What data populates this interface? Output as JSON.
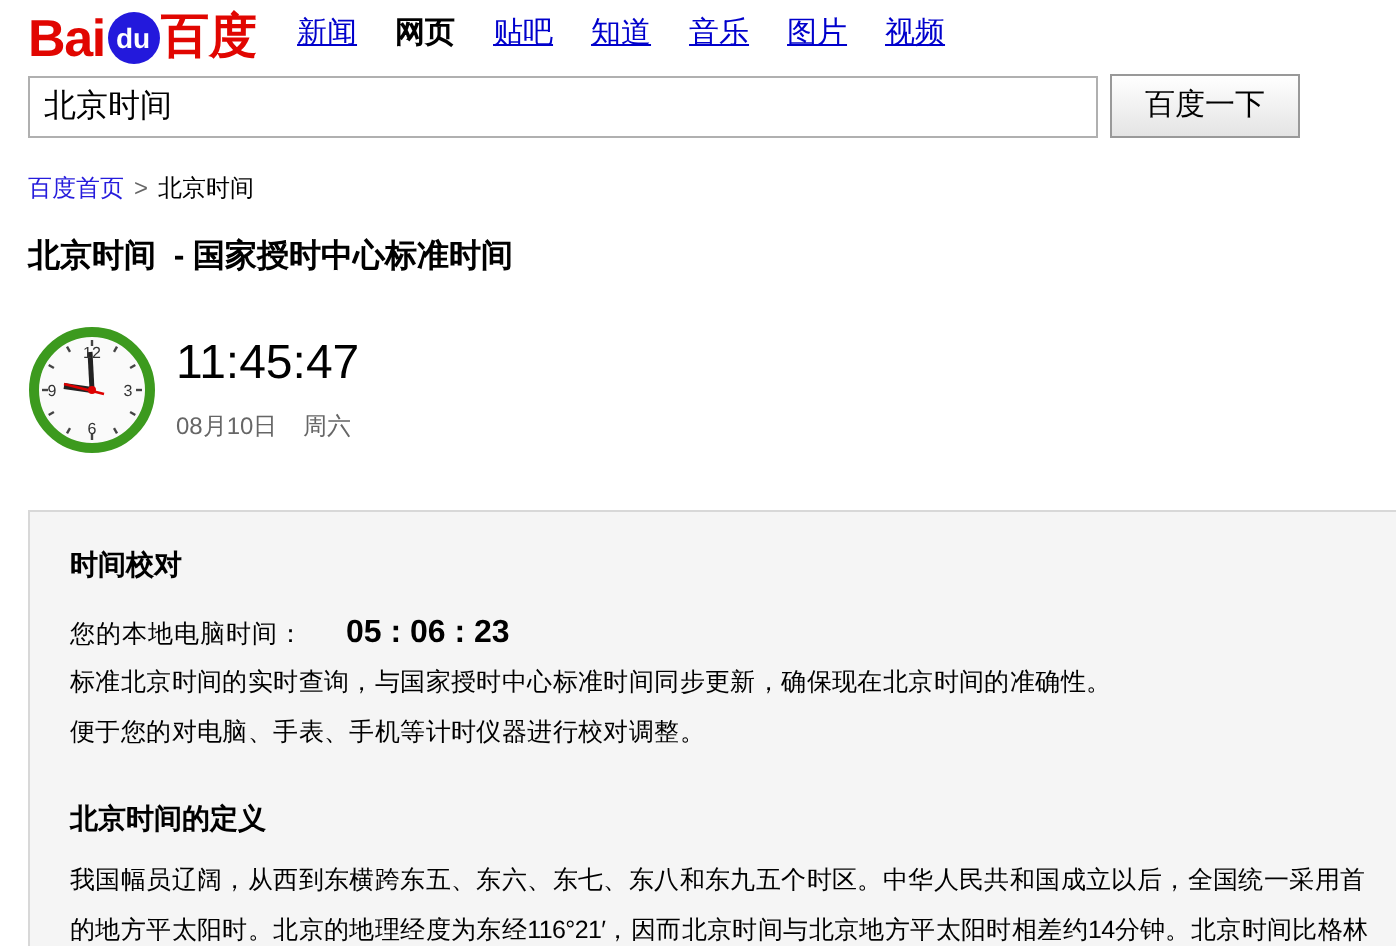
{
  "logo": {
    "left": "Bai",
    "mark": "du",
    "right": "百度"
  },
  "nav": [
    {
      "label": "新闻",
      "selected": false
    },
    {
      "label": "网页",
      "selected": true
    },
    {
      "label": "贴吧",
      "selected": false
    },
    {
      "label": "知道",
      "selected": false
    },
    {
      "label": "音乐",
      "selected": false
    },
    {
      "label": "图片",
      "selected": false
    },
    {
      "label": "视频",
      "selected": false
    }
  ],
  "search": {
    "value": "北京时间",
    "button": "百度一下"
  },
  "breadcrumb": {
    "home": "百度首页",
    "separator": ">",
    "current": "北京时间"
  },
  "result_title": "北京时间  - 国家授时中心标准时间",
  "clock": {
    "numerals": [
      "12",
      "3",
      "6",
      "9"
    ],
    "time": "11:45:47",
    "date": "08月10日",
    "weekday": "周六"
  },
  "panel": {
    "sections": [
      {
        "heading": "时间校对",
        "local_label": "您的本地电脑时间：",
        "local_time": "05 : 06 : 23",
        "lines": [
          "标准北京时间的实时查询，与国家授时中心标准时间同步更新，确保现在北京时间的准确性。",
          "便于您的对电脑、手表、手机等计时仪器进行校对调整。"
        ]
      },
      {
        "heading": "北京时间的定义",
        "lines": [
          "我国幅员辽阔，从西到东横跨东五、东六、东七、东八和东九五个时区。中华人民共和国成立以后，全国统一采用首",
          "的地方平太阳时。北京的地理经度为东经116°21′，因而北京时间与北京地方平太阳时相差约14分钟。北京时间比格林"
        ]
      }
    ]
  }
}
